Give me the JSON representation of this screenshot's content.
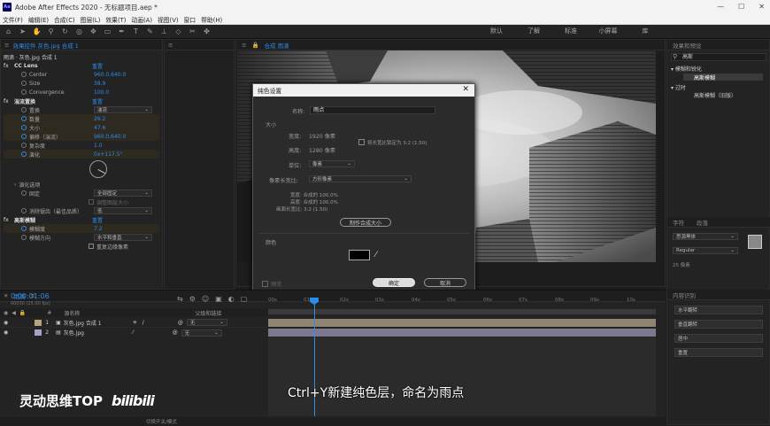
{
  "window": {
    "title": "Adobe After Effects 2020 - 无标题项目.aep *",
    "minimize": "—",
    "maximize": "☐",
    "close": "✕"
  },
  "menu": [
    "文件(F)",
    "编辑(E)",
    "合成(C)",
    "图层(L)",
    "效果(T)",
    "动画(A)",
    "视图(V)",
    "窗口",
    "帮助(H)"
  ],
  "workspaces": [
    "默认",
    "了解",
    "标准",
    "小屏幕",
    "库"
  ],
  "effects_panel": {
    "tab": "效果控件 灰色.jpg 合成 1",
    "breadcrumb": "雨滴 · 灰色.jpg 合成 1",
    "cc_lens": {
      "name": "CC Lens",
      "reset": "重置",
      "center_label": "Center",
      "center_value": "960.0,640.0",
      "size_label": "Size",
      "size_value": "38.9",
      "convergence_label": "Convergence",
      "convergence_value": "100.0"
    },
    "turbulent": {
      "name": "湍流置换",
      "reset": "重置",
      "displace_label": "置换",
      "displace_value": "湍流",
      "amount_label": "数量",
      "amount_value": "26.2",
      "size_label": "大小",
      "size_value": "47.6",
      "offset_label": "偏移（湍流）",
      "offset_value": "960.0,640.0",
      "complexity_label": "复杂度",
      "complexity_value": "1.0",
      "evolution_label": "演化",
      "evolution_value": "0x+117.5°",
      "evolution_options": "演化选项",
      "pin_label": "固定",
      "pin_value": "全部固定",
      "resize_label": "调整图层大小",
      "antialias_label": "消除锯齿（最佳品质）",
      "antialias_value": "低"
    },
    "blur": {
      "name": "高斯模糊",
      "reset": "重置",
      "blurriness_label": "模糊度",
      "blurriness_value": "7.2",
      "dimension_label": "模糊方向",
      "dimension_value": "水平和垂直",
      "repeat_label": "重复边缘像素"
    }
  },
  "comp_panel": {
    "tab": "合成 雨滴"
  },
  "dialog": {
    "title": "纯色设置",
    "name_label": "名称:",
    "name_value": "雨点",
    "size_section": "大小",
    "width_label": "宽度:",
    "width_value": "1920 像素",
    "height_label": "高度:",
    "height_value": "1280 像素",
    "lock_label": "将长宽比锁定为 3:2 (1.50)",
    "unit_label": "单位:",
    "unit_value": "像素",
    "pixel_aspect_label": "像素长宽比:",
    "pixel_aspect_value": "方形像素",
    "info_width": "宽度: 合成的 100.0%",
    "info_height": "高度: 合成的 100.0%",
    "info_aspect": "画面长宽比: 3:2 (1.50)",
    "make_comp_size": "制作合成大小",
    "color_section": "颜色",
    "color_value": "#000000",
    "preview_label": "预览",
    "ok": "确定",
    "cancel": "取消"
  },
  "timeline": {
    "tab": "雨滴",
    "timecode": "0:00:01:06",
    "fps": "00030 (25.00 fps)",
    "source_header": "源名称",
    "parent_header": "父级和链接",
    "layers": [
      {
        "num": "1",
        "name": "灰色.jpg 合成 1",
        "parent": "无",
        "color": "#b5a57a"
      },
      {
        "num": "2",
        "name": "灰色.jpg",
        "parent": "无",
        "color": "#a7a0c8"
      }
    ],
    "ruler": [
      "00s",
      "01s",
      "02s",
      "03s",
      "04s",
      "05s",
      "06s",
      "07s",
      "08s",
      "09s",
      "10s"
    ],
    "toggle_label": "切换开关/模式"
  },
  "right_panel": {
    "effects_tab": "效果和预设",
    "search": "高斯",
    "group1": "▾ 模糊和锐化",
    "item1": "高斯模糊",
    "group2": "▾ 过时",
    "item2": "高斯模糊（旧版）",
    "text_tab": "字符",
    "align_tab": "段落",
    "font_value": "思源黑体",
    "style_value": "Regular",
    "tracking": "25 像素",
    "preview_tab": "内容识别",
    "right_btns": [
      "水平翻转",
      "垂直翻转",
      "居中",
      "重置"
    ]
  },
  "subtitle": "Ctrl+Y新建纯色层，命名为雨点",
  "watermark": {
    "brand": "灵动思维TOP",
    "site": "bilibili"
  }
}
